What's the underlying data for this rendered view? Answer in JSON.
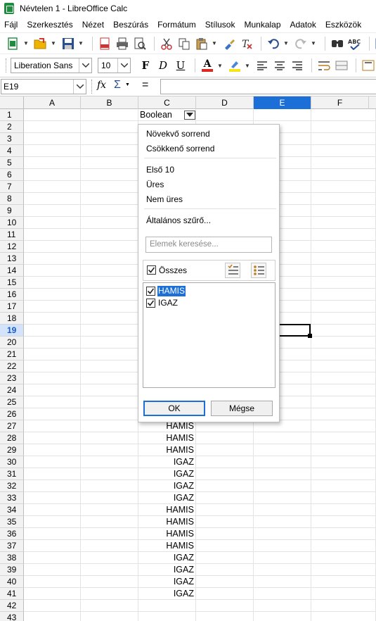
{
  "window": {
    "title": "Névtelen 1 - LibreOffice Calc"
  },
  "menu": [
    "Fájl",
    "Szerkesztés",
    "Nézet",
    "Beszúrás",
    "Formátum",
    "Stílusok",
    "Munkalap",
    "Adatok",
    "Eszközök"
  ],
  "toolbar": {
    "font_name": "Liberation Sans",
    "font_size": "10",
    "bold": "F",
    "italic": "D",
    "underline": "U",
    "font_color_letter": "A",
    "font_color": "#e0291e",
    "highlight_color": "#f5e51f"
  },
  "formula_bar": {
    "name_box": "E19",
    "fx": "fx",
    "sum": "Σ",
    "equals": "="
  },
  "columns": [
    "A",
    "B",
    "C",
    "D",
    "E",
    "F"
  ],
  "selected_column": "E",
  "selected_row": 19,
  "row_numbers": [
    1,
    2,
    3,
    4,
    5,
    6,
    7,
    8,
    9,
    10,
    11,
    12,
    13,
    14,
    15,
    16,
    17,
    18,
    19,
    20,
    21,
    22,
    23,
    24,
    25,
    26,
    27,
    28,
    29,
    30,
    31,
    32,
    33,
    34,
    35,
    36,
    37,
    38,
    39,
    40,
    41,
    42,
    43
  ],
  "header_cell": "Boolean",
  "column_c_values": [
    {
      "row": 27,
      "value": "HAMIS"
    },
    {
      "row": 28,
      "value": "HAMIS"
    },
    {
      "row": 29,
      "value": "HAMIS"
    },
    {
      "row": 30,
      "value": "IGAZ"
    },
    {
      "row": 31,
      "value": "IGAZ"
    },
    {
      "row": 32,
      "value": "IGAZ"
    },
    {
      "row": 33,
      "value": "IGAZ"
    },
    {
      "row": 34,
      "value": "HAMIS"
    },
    {
      "row": 35,
      "value": "HAMIS"
    },
    {
      "row": 36,
      "value": "HAMIS"
    },
    {
      "row": 37,
      "value": "HAMIS"
    },
    {
      "row": 38,
      "value": "IGAZ"
    },
    {
      "row": 39,
      "value": "IGAZ"
    },
    {
      "row": 40,
      "value": "IGAZ"
    },
    {
      "row": 41,
      "value": "IGAZ"
    }
  ],
  "autofilter": {
    "sort_ascending": "Növekvő sorrend",
    "sort_descending": "Csökkenő sorrend",
    "top10": "Első 10",
    "empty": "Üres",
    "not_empty": "Nem üres",
    "standard_filter": "Általános szűrő...",
    "search_placeholder": "Elemek keresése...",
    "all_label": "Összes",
    "items": [
      {
        "label": "HAMIS",
        "checked": true,
        "selected": true
      },
      {
        "label": "IGAZ",
        "checked": true,
        "selected": false
      }
    ],
    "ok": "OK",
    "cancel": "Mégse"
  }
}
